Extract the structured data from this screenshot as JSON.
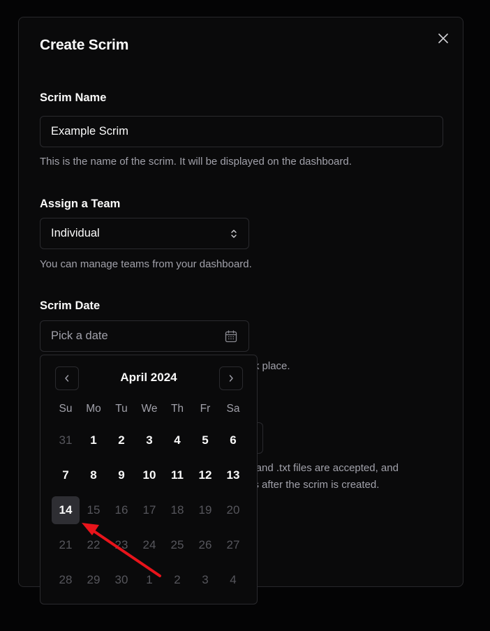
{
  "dialog": {
    "title": "Create Scrim",
    "close_icon": "close-icon"
  },
  "scrim_name": {
    "label": "Scrim Name",
    "value": "Example Scrim",
    "help": "This is the name of the scrim. It will be displayed on the dashboard."
  },
  "team": {
    "label": "Assign a Team",
    "value": "Individual",
    "icon": "chevron-up-down-icon",
    "help": "You can manage teams from your dashboard."
  },
  "scrim_date": {
    "label": "Scrim Date",
    "placeholder": "Pick a date",
    "icon": "calendar-icon",
    "help_tail": "took place."
  },
  "upload_help": {
    "line1_tail": "x and .txt files are accepted, and",
    "line2_tail": "ps after the scrim is created."
  },
  "calendar": {
    "month_label": "April 2024",
    "prev_icon": "chevron-left-icon",
    "next_icon": "chevron-right-icon",
    "weekdays": [
      "Su",
      "Mo",
      "Tu",
      "We",
      "Th",
      "Fr",
      "Sa"
    ],
    "selected_day": "14",
    "days": [
      {
        "label": "31",
        "state": "dim"
      },
      {
        "label": "1",
        "state": "cur"
      },
      {
        "label": "2",
        "state": "cur"
      },
      {
        "label": "3",
        "state": "cur"
      },
      {
        "label": "4",
        "state": "cur"
      },
      {
        "label": "5",
        "state": "cur"
      },
      {
        "label": "6",
        "state": "cur"
      },
      {
        "label": "7",
        "state": "cur"
      },
      {
        "label": "8",
        "state": "cur"
      },
      {
        "label": "9",
        "state": "cur"
      },
      {
        "label": "10",
        "state": "cur"
      },
      {
        "label": "11",
        "state": "cur"
      },
      {
        "label": "12",
        "state": "cur"
      },
      {
        "label": "13",
        "state": "cur"
      },
      {
        "label": "14",
        "state": "sel"
      },
      {
        "label": "15",
        "state": "dim"
      },
      {
        "label": "16",
        "state": "dim"
      },
      {
        "label": "17",
        "state": "dim"
      },
      {
        "label": "18",
        "state": "dim"
      },
      {
        "label": "19",
        "state": "dim"
      },
      {
        "label": "20",
        "state": "dim"
      },
      {
        "label": "21",
        "state": "dim"
      },
      {
        "label": "22",
        "state": "dim"
      },
      {
        "label": "23",
        "state": "dim"
      },
      {
        "label": "24",
        "state": "dim"
      },
      {
        "label": "25",
        "state": "dim"
      },
      {
        "label": "26",
        "state": "dim"
      },
      {
        "label": "27",
        "state": "dim"
      },
      {
        "label": "28",
        "state": "dim"
      },
      {
        "label": "29",
        "state": "dim"
      },
      {
        "label": "30",
        "state": "dim"
      },
      {
        "label": "1",
        "state": "dim"
      },
      {
        "label": "2",
        "state": "dim"
      },
      {
        "label": "3",
        "state": "dim"
      },
      {
        "label": "4",
        "state": "dim"
      }
    ]
  },
  "annotation": {
    "arrow_color": "#e8141b"
  }
}
